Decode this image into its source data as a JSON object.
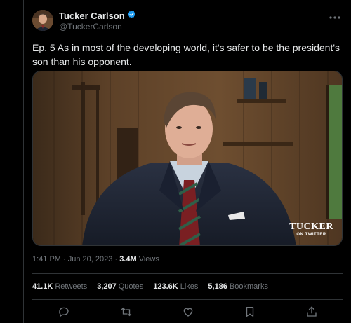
{
  "author": {
    "name": "Tucker Carlson",
    "handle": "@TuckerCarlson",
    "verified_icon": "verified-badge-icon"
  },
  "tweet": {
    "text": "Ep. 5  As in most of the developing world, it's safer to be the president's son than his opponent."
  },
  "media": {
    "watermark_title": "TUCKER",
    "watermark_subtitle": "ON TWITTER"
  },
  "meta": {
    "time": "1:41 PM",
    "separator": "·",
    "date": "Jun 20, 2023",
    "views_count": "3.4M",
    "views_label": "Views"
  },
  "stats": {
    "retweets_count": "41.1K",
    "retweets_label": "Retweets",
    "quotes_count": "3,207",
    "quotes_label": "Quotes",
    "likes_count": "123.6K",
    "likes_label": "Likes",
    "bookmarks_count": "5,186",
    "bookmarks_label": "Bookmarks"
  },
  "actions": [
    "reply-icon",
    "retweet-icon",
    "like-icon",
    "bookmark-icon",
    "share-icon"
  ],
  "colors": {
    "background": "#000000",
    "text": "#e7e9ea",
    "muted": "#71767b",
    "border": "#2f3336",
    "verified": "#1d9bf0"
  }
}
